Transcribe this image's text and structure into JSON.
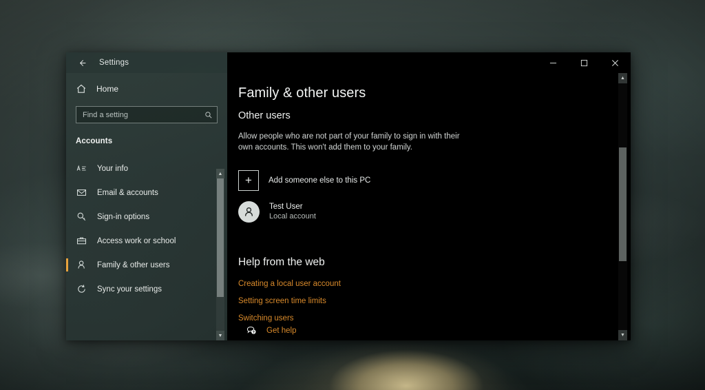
{
  "window": {
    "app_title": "Settings",
    "back_icon": "back-arrow-icon",
    "controls": {
      "minimize": "minimize-icon",
      "maximize": "maximize-icon",
      "close": "close-icon"
    }
  },
  "sidebar": {
    "home": {
      "label": "Home",
      "icon": "home-icon"
    },
    "search": {
      "placeholder": "Find a setting",
      "value": "",
      "icon": "search-icon"
    },
    "heading": "Accounts",
    "items": [
      {
        "label": "Your info",
        "icon": "contact-card-icon",
        "selected": false
      },
      {
        "label": "Email & accounts",
        "icon": "envelope-icon",
        "selected": false
      },
      {
        "label": "Sign-in options",
        "icon": "key-search-icon",
        "selected": false
      },
      {
        "label": "Access work or school",
        "icon": "briefcase-icon",
        "selected": false
      },
      {
        "label": "Family & other users",
        "icon": "person-icon",
        "selected": true
      },
      {
        "label": "Sync your settings",
        "icon": "sync-icon",
        "selected": false
      }
    ],
    "accent_color": "#e8a33d"
  },
  "main": {
    "page_title": "Family & other users",
    "section_title": "Other users",
    "section_description": "Allow people who are not part of your family to sign in with their own accounts. This won't add them to your family.",
    "add_user": {
      "label": "Add someone else to this PC",
      "icon": "plus-icon"
    },
    "user": {
      "name": "Test User",
      "account_type": "Local account",
      "avatar_icon": "person-avatar-icon"
    },
    "help": {
      "title": "Help from the web",
      "links": [
        "Creating a local user account",
        "Setting screen time limits",
        "Switching users"
      ],
      "link_color": "#d98a2b"
    },
    "get_help": {
      "label": "Get help",
      "icon": "help-chat-icon"
    }
  }
}
